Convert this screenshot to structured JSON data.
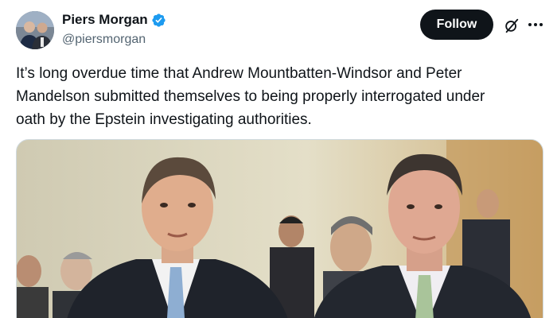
{
  "author": {
    "display_name": "Piers Morgan",
    "handle": "@piersmorgan",
    "verified": true,
    "verified_color": "#1d9bf0"
  },
  "actions": {
    "follow_label": "Follow",
    "grok_icon": "grok-icon",
    "more_icon": "more-icon"
  },
  "post": {
    "text": "It’s long overdue time that Andrew Mountbatten-Windsor and Peter\nMandelson submitted themselves to being properly interrogated under\noath by the Epstein investigating authorities."
  },
  "media": {
    "kind": "photo"
  },
  "colors": {
    "text": "#0f1419",
    "secondary": "#536471",
    "follow_bg": "#0f1419",
    "follow_text": "#ffffff",
    "border": "#cfd9de"
  }
}
